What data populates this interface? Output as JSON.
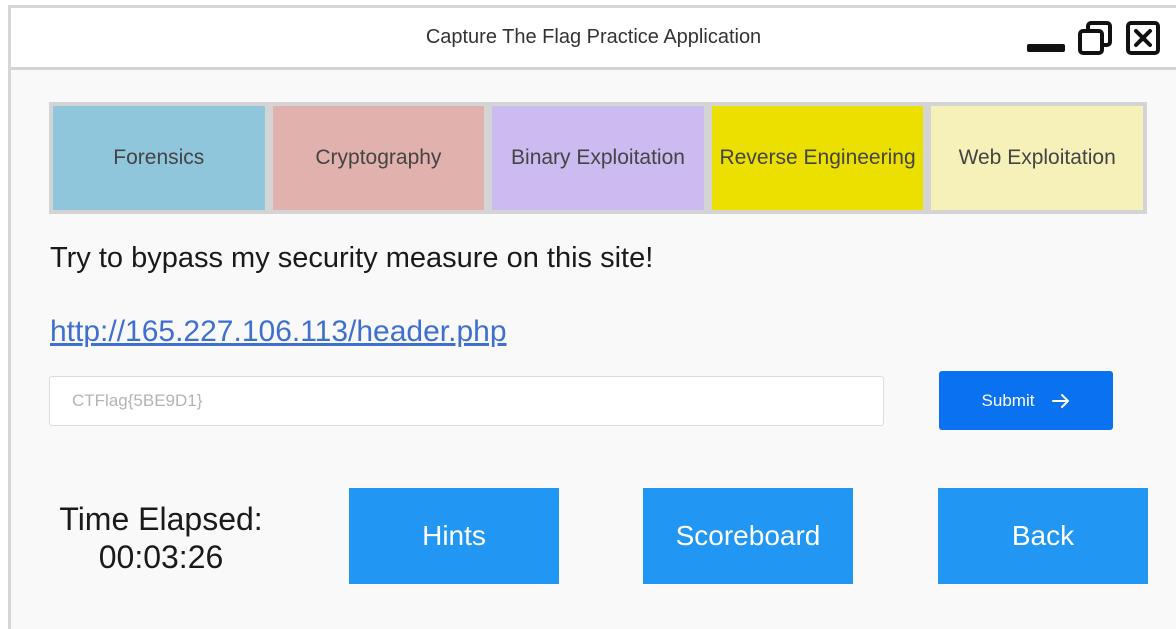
{
  "window": {
    "title": "Capture The Flag Practice Application"
  },
  "categories": [
    {
      "label": "Forensics",
      "color": "#8fc6dc"
    },
    {
      "label": "Cryptography",
      "color": "#e1b1ad"
    },
    {
      "label": "Binary Exploitation",
      "color": "#ccbbf0"
    },
    {
      "label": "Reverse Engineering",
      "color": "#ece000"
    },
    {
      "label": "Web Exploitation",
      "color": "#f5f1b8"
    }
  ],
  "challenge": {
    "prompt": "Try to bypass my security measure on this site!",
    "link": "http://165.227.106.113/header.php"
  },
  "flag_input": {
    "placeholder": "CTFlag{5BE9D1}",
    "value": ""
  },
  "submit": {
    "label": "Submit",
    "icon": "arrow-right-icon",
    "color": "#0a72f0"
  },
  "timer": {
    "label": "Time Elapsed:",
    "value": "00:03:26"
  },
  "actions": {
    "hints": "Hints",
    "scoreboard": "Scoreboard",
    "back": "Back",
    "color": "#2196f3"
  }
}
